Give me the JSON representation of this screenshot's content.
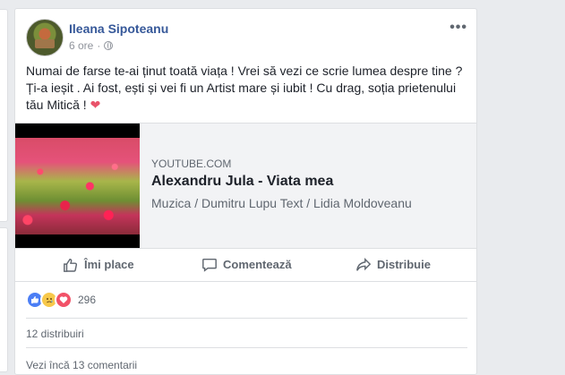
{
  "post": {
    "author": "Ileana Sipoteanu",
    "time": "6 ore",
    "meta_separator": "·",
    "more_label": "•••",
    "text": "Numai de farse te-ai ținut toată viața ! Vrei să vezi ce scrie lumea despre tine ? Ți-a ieșit . Ai fost, ești și vei fi un Artist mare și iubit ! Cu drag, soția prietenului tău Mitică !",
    "heart": "❤"
  },
  "link": {
    "domain": "YOUTUBE.COM",
    "title": "Alexandru Jula - Viata mea",
    "description": "Muzica / Dumitru Lupu Text / Lidia Moldoveanu"
  },
  "actions": {
    "like": "Îmi place",
    "comment": "Comentează",
    "share": "Distribuie"
  },
  "reactions": {
    "count": "296",
    "types": [
      "like",
      "sad",
      "love"
    ]
  },
  "stats": {
    "shares": "12 distribuiri",
    "comments": "Vezi încă 13 comentarii"
  },
  "colors": {
    "link_blue": "#365899",
    "like_blue": "#4b7ef5",
    "love_red": "#f25268",
    "sad_yellow": "#f7c84a"
  }
}
